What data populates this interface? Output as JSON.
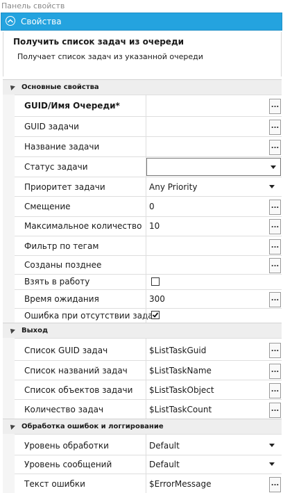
{
  "panel": {
    "title": "Панель свойств"
  },
  "header": {
    "title": "Свойства"
  },
  "activity": {
    "title": "Получить список задач из очереди",
    "description": "Получает список задач из указанной очереди"
  },
  "categories": {
    "main": "Основные свойства",
    "output": "Выход",
    "errors": "Обработка ошибок и логгирование"
  },
  "main_props": {
    "queue_guid": {
      "label": "GUID/Имя Очереди*",
      "value": ""
    },
    "task_guid": {
      "label": "GUID задачи",
      "value": ""
    },
    "task_name": {
      "label": "Название задачи",
      "value": ""
    },
    "task_status": {
      "label": "Статус задачи",
      "value": ""
    },
    "task_priority": {
      "label": "Приоритет задачи",
      "value": "Any Priority"
    },
    "offset": {
      "label": "Смещение",
      "value": "0"
    },
    "max_count": {
      "label": "Максимальное количество",
      "value": "10"
    },
    "tag_filter": {
      "label": "Фильтр по тегам",
      "value": ""
    },
    "created_after": {
      "label": "Созданы позднее",
      "value": ""
    },
    "take_to_work": {
      "label": "Взять в работу",
      "checked": false
    },
    "timeout": {
      "label": "Время ожидания",
      "value": "300"
    },
    "error_if_empty": {
      "label": "Ошибка при отсутствии задач",
      "checked": true
    }
  },
  "output_props": {
    "guid_list": {
      "label": "Список GUID задач",
      "value": "$ListTaskGuid"
    },
    "name_list": {
      "label": "Список названий задач",
      "value": "$ListTaskName"
    },
    "object_list": {
      "label": "Список объектов задачи",
      "value": "$ListTaskObject"
    },
    "count": {
      "label": "Количество задач",
      "value": "$ListTaskCount"
    }
  },
  "error_props": {
    "handling_level": {
      "label": "Уровень обработки",
      "value": "Default"
    },
    "message_level": {
      "label": "Уровень сообщений",
      "value": "Default"
    },
    "error_text": {
      "label": "Текст ошибки",
      "value": "$ErrorMessage"
    }
  },
  "ellipsis": "...",
  "colors": {
    "header": "#24a3df",
    "category_bg": "#eeeeee"
  }
}
